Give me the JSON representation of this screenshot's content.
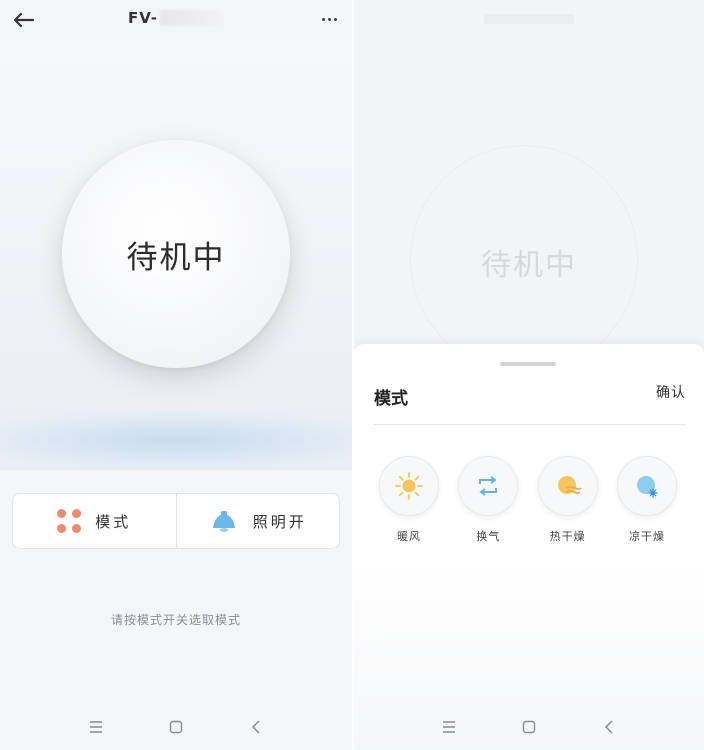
{
  "left": {
    "header": {
      "title": "FV-"
    },
    "status": "待机中",
    "controls": [
      {
        "label": "模式",
        "icon": "mode-grid-icon"
      },
      {
        "label": "照明开",
        "icon": "bell-light-icon"
      }
    ],
    "hint": "请按模式开关选取模式"
  },
  "right": {
    "background_status": "待机中",
    "sheet": {
      "title": "模式",
      "confirm": "确认",
      "modes": [
        {
          "label": "暖风",
          "icon": "sun-icon"
        },
        {
          "label": "换气",
          "icon": "cycle-icon"
        },
        {
          "label": "热干燥",
          "icon": "dry-hot-icon"
        },
        {
          "label": "凉干燥",
          "icon": "snow-icon"
        }
      ]
    }
  },
  "navbar": [
    "menu-icon",
    "home-square-icon",
    "back-chevron-icon"
  ],
  "colors": {
    "accent": "#ef8a70",
    "sky": "#67b5e6",
    "sun": "#f5c55c"
  }
}
